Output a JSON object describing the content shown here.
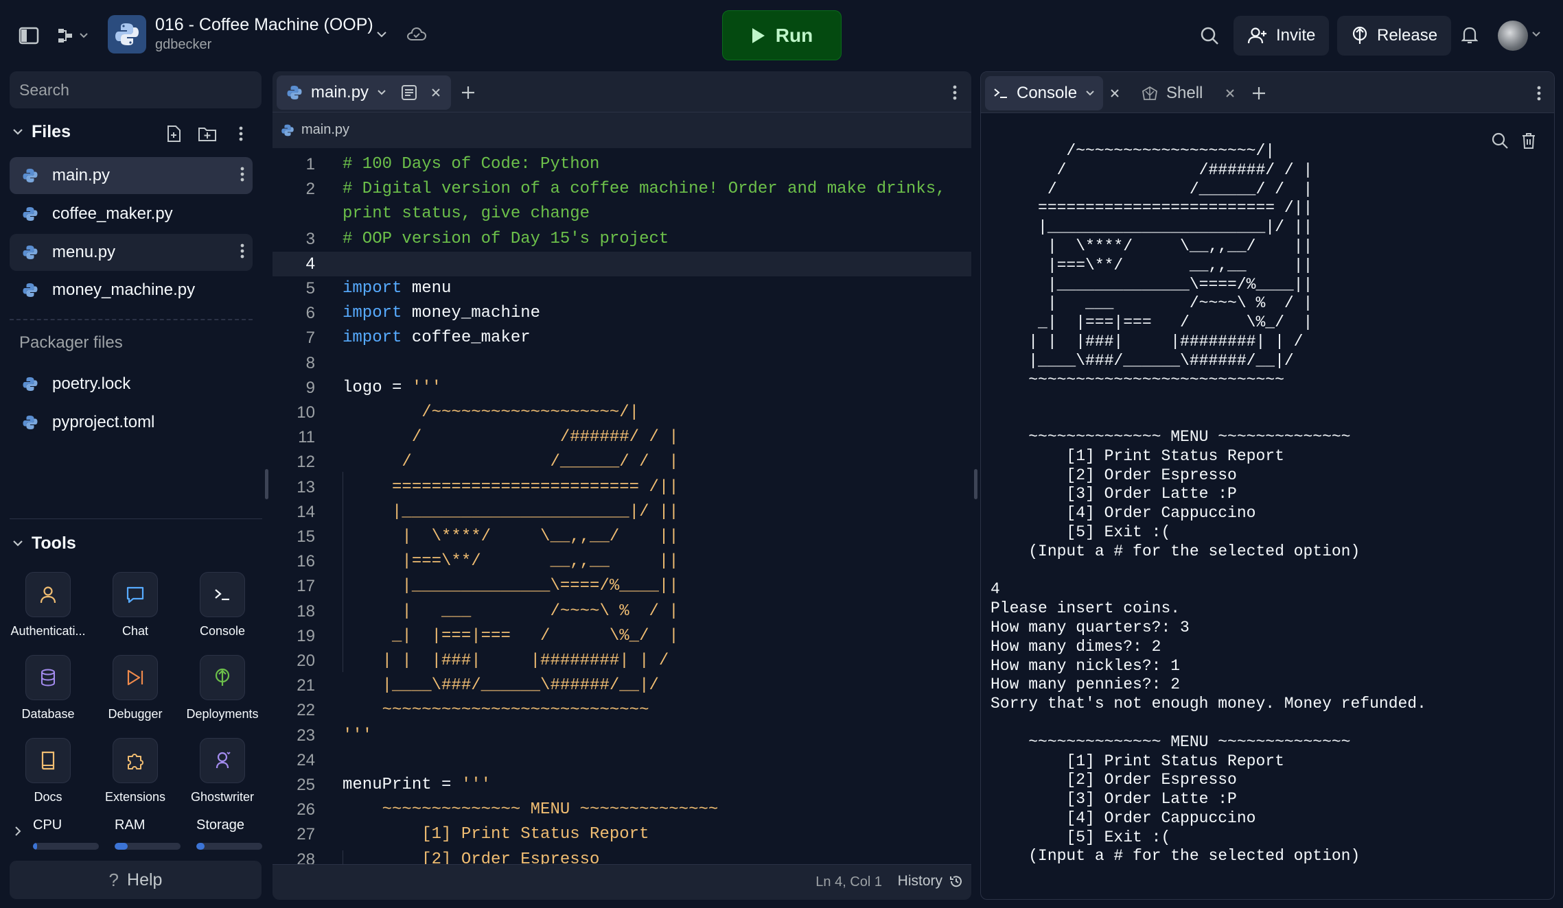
{
  "topbar": {
    "project_title": "016 - Coffee Machine (OOP)",
    "project_owner": "gdbecker",
    "run_label": "Run",
    "invite_label": "Invite",
    "release_label": "Release"
  },
  "sidebar": {
    "search_placeholder": "Search",
    "files_title": "Files",
    "files": [
      {
        "name": "main.py"
      },
      {
        "name": "coffee_maker.py"
      },
      {
        "name": "menu.py"
      },
      {
        "name": "money_machine.py"
      }
    ],
    "packager_title": "Packager files",
    "packager_files": [
      {
        "name": "poetry.lock"
      },
      {
        "name": "pyproject.toml"
      }
    ],
    "tools_title": "Tools",
    "tools": [
      {
        "label": "Authenticati...",
        "icon": "person-icon"
      },
      {
        "label": "Chat",
        "icon": "chat-icon"
      },
      {
        "label": "Console",
        "icon": "terminal-icon"
      },
      {
        "label": "Database",
        "icon": "database-icon"
      },
      {
        "label": "Debugger",
        "icon": "debugger-icon"
      },
      {
        "label": "Deployments",
        "icon": "deployments-icon"
      },
      {
        "label": "Docs",
        "icon": "book-icon"
      },
      {
        "label": "Extensions",
        "icon": "puzzle-icon"
      },
      {
        "label": "Ghostwriter",
        "icon": "ghostwriter-icon"
      }
    ],
    "resources": [
      {
        "label": "CPU",
        "usage": 0.05
      },
      {
        "label": "RAM",
        "usage": 0.2
      },
      {
        "label": "Storage",
        "usage": 0.12
      }
    ],
    "help_label": "Help"
  },
  "editor": {
    "tab_label": "main.py",
    "breadcrumb": "main.py",
    "current_line": 4,
    "lines": [
      {
        "n": "1",
        "t": "# 100 Days of Code: Python",
        "c": "cmt"
      },
      {
        "n": "2",
        "t": "# Digital version of a coffee machine! Order and make drinks,",
        "c": "cmt"
      },
      {
        "n": "",
        "t": "print status, give change",
        "c": "cmt"
      },
      {
        "n": "3",
        "t": "# OOP version of Day 15's project",
        "c": "cmt"
      },
      {
        "n": "4",
        "t": "",
        "c": "id"
      },
      {
        "n": "5",
        "kw": "import",
        "t": " menu",
        "c": "id"
      },
      {
        "n": "6",
        "kw": "import",
        "t": " money_machine",
        "c": "id"
      },
      {
        "n": "7",
        "kw": "import",
        "t": " coffee_maker",
        "c": "id"
      },
      {
        "n": "8",
        "t": "",
        "c": "id"
      },
      {
        "n": "9",
        "t": "logo = ",
        "c": "id",
        "s": "'''"
      },
      {
        "n": "10",
        "t": "        /~~~~~~~~~~~~~~~~~~~/|",
        "c": "str"
      },
      {
        "n": "11",
        "t": "       /              /######/ / |",
        "c": "str"
      },
      {
        "n": "12",
        "t": "      /              /______/ /  |",
        "c": "str"
      },
      {
        "n": "13",
        "t": "     ========================= /||",
        "c": "str"
      },
      {
        "n": "14",
        "t": "     |_______________________|/ ||",
        "c": "str"
      },
      {
        "n": "15",
        "t": "      |  \\****/     \\__,,__/    ||",
        "c": "str"
      },
      {
        "n": "16",
        "t": "      |===\\**/       __,,__     ||",
        "c": "str"
      },
      {
        "n": "17",
        "t": "      |______________\\====/%____||",
        "c": "str"
      },
      {
        "n": "18",
        "t": "      |   ___        /~~~~\\ %  / |",
        "c": "str"
      },
      {
        "n": "19",
        "t": "     _|  |===|===   /      \\%_/  |",
        "c": "str"
      },
      {
        "n": "20",
        "t": "    | |  |###|     |########| | /",
        "c": "str"
      },
      {
        "n": "21",
        "t": "    |____\\###/______\\######/__|/",
        "c": "str"
      },
      {
        "n": "22",
        "t": "    ~~~~~~~~~~~~~~~~~~~~~~~~~~~",
        "c": "str"
      },
      {
        "n": "23",
        "t": "'''",
        "c": "str"
      },
      {
        "n": "24",
        "t": "",
        "c": "id"
      },
      {
        "n": "25",
        "t": "menuPrint = ",
        "c": "id",
        "s": "'''"
      },
      {
        "n": "26",
        "t": "    ~~~~~~~~~~~~~~ MENU ~~~~~~~~~~~~~~",
        "c": "str"
      },
      {
        "n": "27",
        "t": "        [1] Print Status Report",
        "c": "str"
      },
      {
        "n": "28",
        "t": "        [2] Order Espresso",
        "c": "str"
      }
    ],
    "cursor_position": "Ln 4, Col 1",
    "history_label": "History"
  },
  "console": {
    "tabs": [
      {
        "label": "Console"
      },
      {
        "label": "Shell"
      }
    ],
    "output": "        /~~~~~~~~~~~~~~~~~~~/|\n       /              /######/ / |\n      /              /______/ /  |\n     ========================= /||\n     |_______________________|/ ||\n      |  \\****/     \\__,,__/    ||\n      |===\\**/       __,,__     ||\n      |______________\\====/%____||\n      |   ___        /~~~~\\ %  / |\n     _|  |===|===   /      \\%_/  |\n    | |  |###|     |########| | /\n    |____\\###/______\\######/__|/\n    ~~~~~~~~~~~~~~~~~~~~~~~~~~~\n\n\n    ~~~~~~~~~~~~~~ MENU ~~~~~~~~~~~~~~\n        [1] Print Status Report\n        [2] Order Espresso\n        [3] Order Latte :P\n        [4] Order Cappuccino\n        [5] Exit :(\n    (Input a # for the selected option)\n\n4\nPlease insert coins.\nHow many quarters?: 3\nHow many dimes?: 2\nHow many nickles?: 1\nHow many pennies?: 2\nSorry that's not enough money. Money refunded.\n\n    ~~~~~~~~~~~~~~ MENU ~~~~~~~~~~~~~~\n        [1] Print Status Report\n        [2] Order Espresso\n        [3] Order Latte :P\n        [4] Order Cappuccino\n        [5] Exit :(\n    (Input a # for the selected option)"
  },
  "colors": {
    "background": "#0e1525",
    "panel": "#1c2333",
    "run_green": "#044a10",
    "comment": "#6cc04a",
    "keyword": "#57abff",
    "string": "#f0bd72"
  }
}
